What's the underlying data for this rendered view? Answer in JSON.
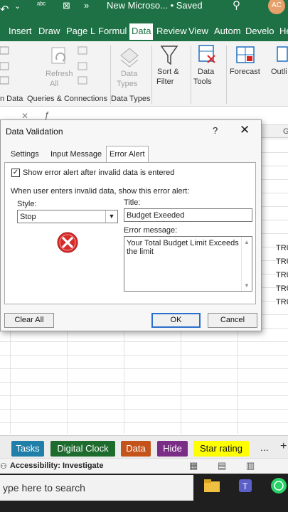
{
  "window": {
    "title": "New Microso... • Saved",
    "avatar": "AC"
  },
  "ribbon_tabs": [
    "Insert",
    "Draw",
    "Page L",
    "Formul",
    "Data",
    "Review",
    "View",
    "Autom",
    "Develo",
    "He"
  ],
  "active_tab": "Data",
  "ribbon": {
    "refresh_label": "Refresh",
    "refresh_sub": "All",
    "data_types": "Data",
    "data_types_sub": "Types",
    "sort_filter": "Sort &",
    "sort_filter_sub": "Filter",
    "data_tools": "Data",
    "data_tools_sub": "Tools",
    "forecast": "Forecast",
    "outline": "Outli",
    "group_get_data": "n Data",
    "group_queries": "Queries & Connections",
    "group_data_types": "Data Types"
  },
  "grid": {
    "col_g": "G",
    "tru_cells": [
      "TRU",
      "TRU",
      "TRU",
      "TRU",
      "TRU"
    ]
  },
  "dialog": {
    "title": "Data Validation",
    "help": "?",
    "close": "✕",
    "tabs": [
      "Settings",
      "Input Message",
      "Error Alert"
    ],
    "active_tab": "Error Alert",
    "show_alert_label": "Show error alert after invalid data is entered",
    "show_alert_checked": true,
    "invalid_note": "When user enters invalid data, show this error alert:",
    "style_label": "Style:",
    "style_value": "Stop",
    "title_label": "Title:",
    "title_value": "Budget Exeeded",
    "message_label": "Error message:",
    "message_value": "Your Total Budget Limit Exceeds the limit",
    "clear_all": "Clear All",
    "ok": "OK",
    "cancel": "Cancel"
  },
  "sheets": [
    {
      "label": "Tasks",
      "color": "#1f7fa8"
    },
    {
      "label": "Digital Clock",
      "color": "#1e6b2e"
    },
    {
      "label": "Data",
      "color": "#c4531a"
    },
    {
      "label": "Hide",
      "color": "#7a2c86"
    },
    {
      "label": "Star rating",
      "color": "#ffff00"
    }
  ],
  "sheet_more": "...",
  "sheet_add": "+",
  "status": {
    "accessibility": "Accessibility: Investigate"
  },
  "taskbar": {
    "search_placeholder": "ype here to search"
  }
}
